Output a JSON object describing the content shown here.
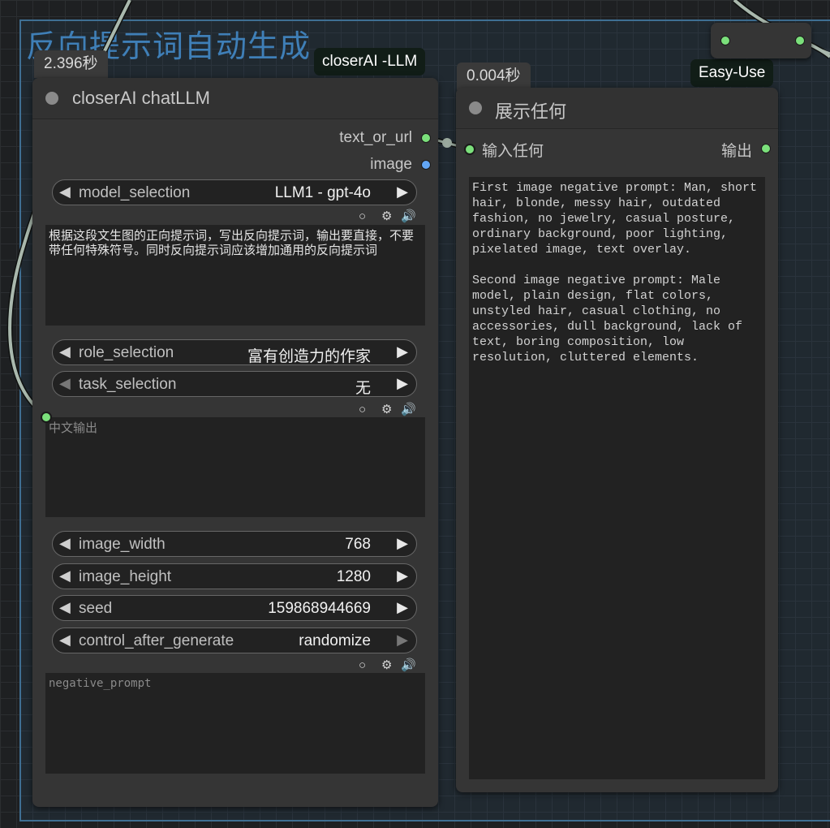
{
  "group": {
    "title": "反向提示词自动生成"
  },
  "badges": {
    "llm_time": "2.396秒",
    "llm_category": "closerAI -LLM",
    "display_time": "0.004秒",
    "display_category": "Easy-Use"
  },
  "llm_node": {
    "title": "closerAI chatLLM",
    "outputs": {
      "text_or_url": "text_or_url",
      "image": "image"
    },
    "model_selection": {
      "name": "model_selection",
      "value": "LLM1 - gpt-4o"
    },
    "prompt_text": "根据这段文生图的正向提示词，写出反向提示词，输出要直接，不要带任何特殊符号。同时反向提示词应该增加通用的反向提示词",
    "role_selection": {
      "name": "role_selection",
      "value": "富有创造力的作家"
    },
    "task_selection": {
      "name": "task_selection",
      "value": "无"
    },
    "chinese_output_placeholder": "中文输出",
    "image_width": {
      "name": "image_width",
      "value": "768"
    },
    "image_height": {
      "name": "image_height",
      "value": "1280"
    },
    "seed": {
      "name": "seed",
      "value": "159868944669"
    },
    "control_after_generate": {
      "name": "control_after_generate",
      "value": "randomize"
    },
    "negative_prompt_placeholder": "negative_prompt"
  },
  "display_node": {
    "title": "展示任何",
    "input_label": "输入任何",
    "output_label": "输出",
    "content": "First image negative prompt: Man, short hair, blonde, messy hair, outdated fashion, no jewelry, casual posture, ordinary background, poor lighting, pixelated image, text overlay.\n\nSecond image negative prompt: Male model, plain design, flat colors, unstyled hair, casual clothing, no accessories, dull background, lack of text, boring composition, low resolution, cluttered elements."
  },
  "colors": {
    "port_green": "#7be07b",
    "port_blue": "#62a6f5",
    "group_border": "#3f6f93",
    "group_title": "#3f7fb7"
  }
}
